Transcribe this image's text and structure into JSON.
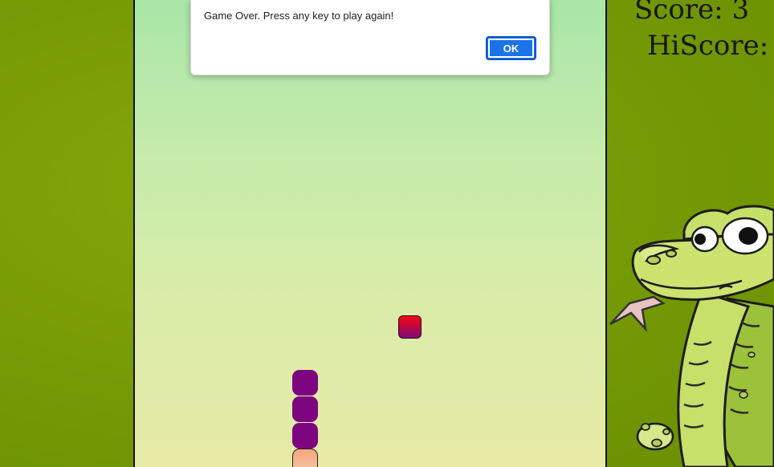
{
  "dialog": {
    "message": "Game Over. Press any key to play again!",
    "ok_label": "OK"
  },
  "scoreboard": {
    "score_text": "Score: 3",
    "hiscore_text": "HiScore:"
  },
  "game": {
    "snake_length": 4,
    "colors": {
      "board_top": "#a8e6a8",
      "board_bottom": "#e8eba6",
      "snake_body": "#7d0680",
      "snake_head": "#f7a77e",
      "food_top": "#f00d14",
      "food_bottom": "#7e0a7e",
      "background": "#789c05"
    }
  },
  "icons": {
    "mascot": "cartoon-snake-icon"
  }
}
